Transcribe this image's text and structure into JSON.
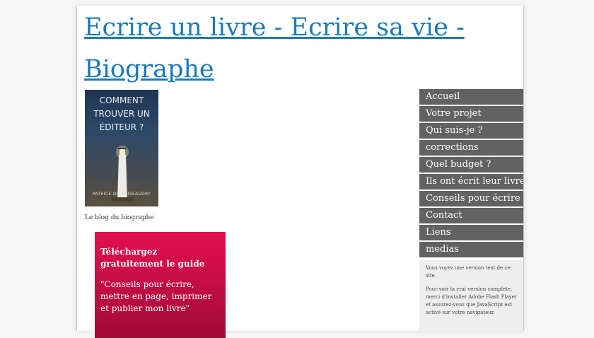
{
  "site": {
    "title": "Ecrire un livre - Ecrire sa vie - Biographe"
  },
  "sidebar_left": {
    "book": {
      "title": "COMMENT TROUVER UN ÉDITEUR ?",
      "author": "PATRICE DU BOISEAUDRY"
    },
    "caption": "Le blog du biographe",
    "promo": {
      "heading": "Téléchargez gratuitement le guide",
      "quote": "\"Conseils pour écrire, mettre en page, imprimer et publier mon livre\""
    }
  },
  "nav": {
    "items": [
      "Accueil",
      "Votre projet",
      "Qui suis-je ?",
      "corrections",
      "Quel budget ?",
      "Ils ont écrit leur livre",
      "Conseils pour écrire",
      "Contact",
      "Liens",
      "medias"
    ]
  },
  "flash_notice": {
    "line1": "Vous voyez une version text de ce site.",
    "line2": "Pour voir la vrai version complète, merci d'installer Adobe Flash Player et assurez-vous que JavaScript est activé sur votre navigateur."
  },
  "colors": {
    "title_link": "#1a7ab8",
    "nav_bg": "#626262",
    "promo_bg": "#d80e4b"
  }
}
